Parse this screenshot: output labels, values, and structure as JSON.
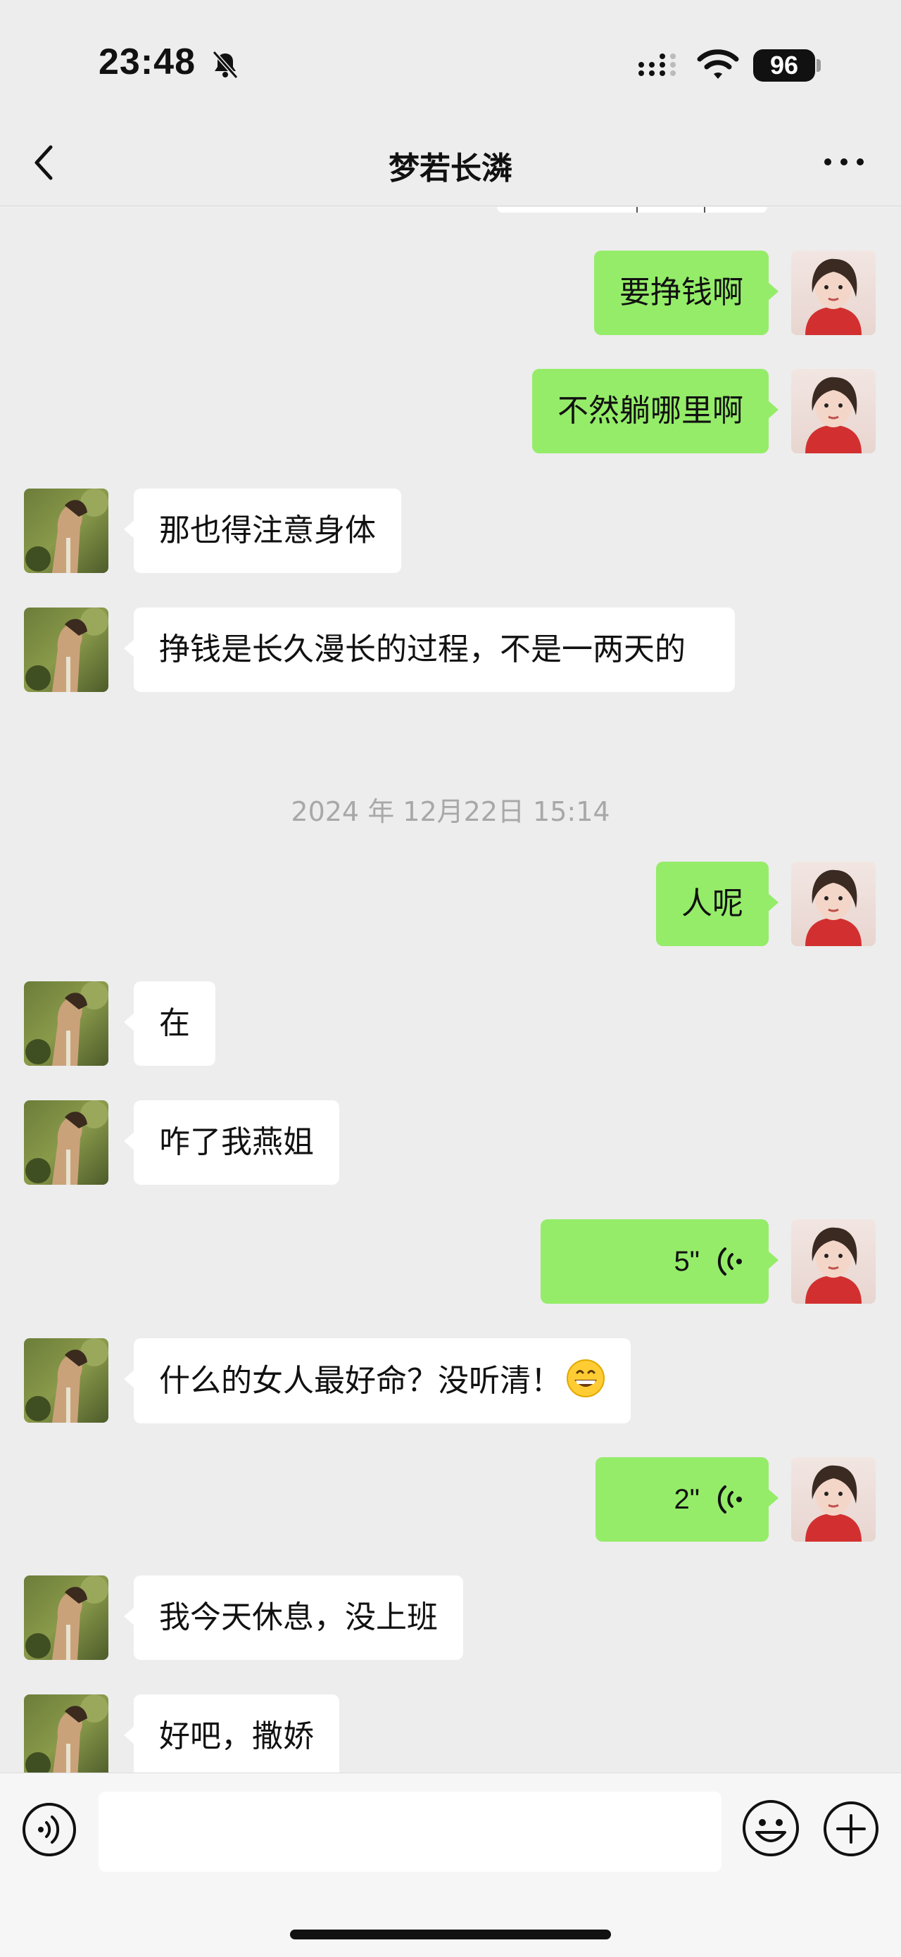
{
  "status_bar": {
    "time": "23:48",
    "battery": "96"
  },
  "header": {
    "title": "梦若长潾"
  },
  "messages": [
    {
      "side": "right",
      "type": "text",
      "text": "要挣钱啊"
    },
    {
      "side": "right",
      "type": "text",
      "text": "不然躺哪里啊"
    },
    {
      "side": "left",
      "type": "text",
      "text": "那也得注意身体"
    },
    {
      "side": "left",
      "type": "text",
      "text": "挣钱是长久漫长的过程，不是一两天的"
    },
    {
      "type": "timestamp",
      "text": "2024 年 12月22日 15:14"
    },
    {
      "side": "right",
      "type": "text",
      "text": "人呢"
    },
    {
      "side": "left",
      "type": "text",
      "text": "在"
    },
    {
      "side": "left",
      "type": "text",
      "text": "咋了我燕姐"
    },
    {
      "side": "right",
      "type": "voice",
      "duration": "5\""
    },
    {
      "side": "left",
      "type": "text",
      "text": "什么的女人最好命？没听清！",
      "emoji": "grinning-face"
    },
    {
      "side": "right",
      "type": "voice",
      "duration": "2\""
    },
    {
      "side": "left",
      "type": "text",
      "text": "我今天休息，没上班"
    },
    {
      "side": "left",
      "type": "text",
      "text": "好吧，撒娇"
    }
  ],
  "input": {
    "value": ""
  },
  "colors": {
    "background": "#ededed",
    "sent_bubble": "#95ec69",
    "received_bubble": "#ffffff",
    "timestamp_text": "#a8a8a8"
  },
  "icons": {
    "back": "chevron-left-icon",
    "more": "more-dots-icon",
    "mute": "bell-off-icon",
    "voice": "voice-wave-icon",
    "emoji": "smiley-icon",
    "plus": "plus-circle-icon"
  }
}
